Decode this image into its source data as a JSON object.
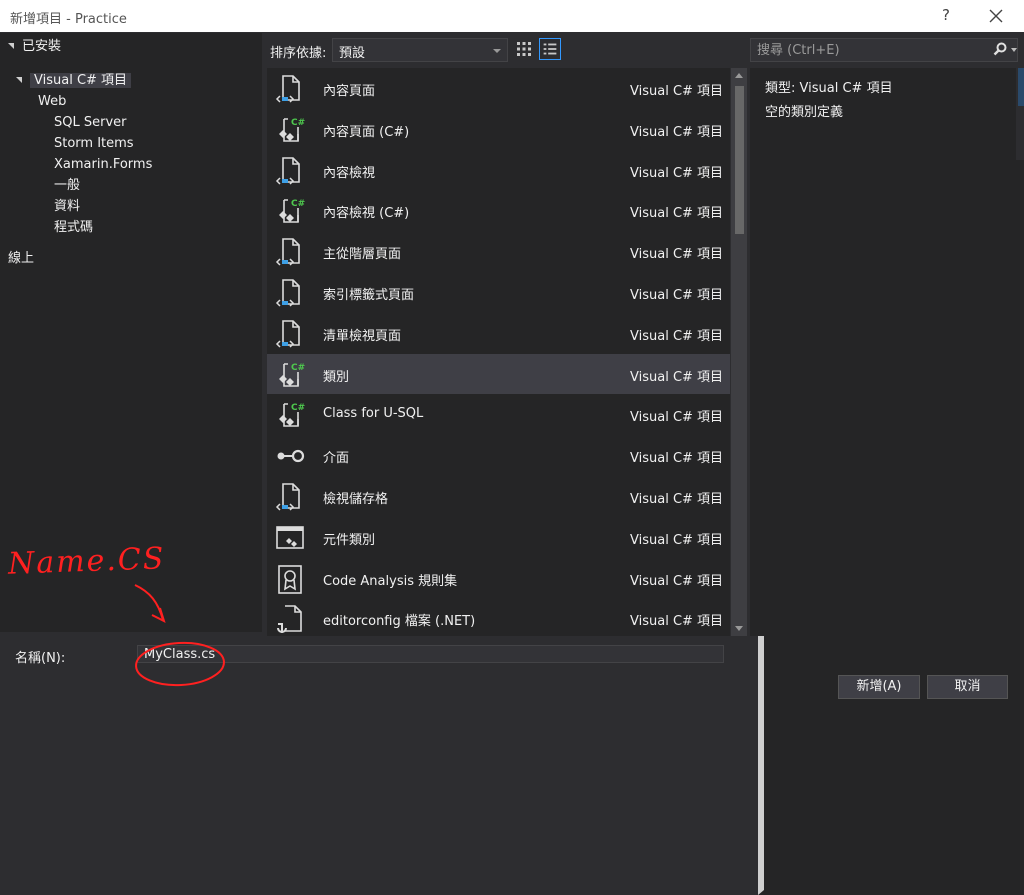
{
  "window": {
    "title": "新增項目 - Practice",
    "help_glyph": "?"
  },
  "tree": {
    "installed": "已安裝",
    "selected": "Visual C# 項目",
    "children": [
      "Web",
      "SQL Server",
      "Storm Items",
      "Xamarin.Forms",
      "一般",
      "資料",
      "程式碼"
    ],
    "online": "線上"
  },
  "toolbar": {
    "sort_label": "排序依據:",
    "sort_value": "預設"
  },
  "search": {
    "placeholder": "搜尋 (Ctrl+E)"
  },
  "templates": [
    {
      "name": "內容頁面",
      "type": "Visual C# 項目",
      "icon": "page-icon"
    },
    {
      "name": "內容頁面 (C#)",
      "type": "Visual C# 項目",
      "icon": "csharp-class-icon"
    },
    {
      "name": "內容檢視",
      "type": "Visual C# 項目",
      "icon": "page-icon"
    },
    {
      "name": "內容檢視 (C#)",
      "type": "Visual C# 項目",
      "icon": "csharp-class-icon"
    },
    {
      "name": "主從階層頁面",
      "type": "Visual C# 項目",
      "icon": "page-icon"
    },
    {
      "name": "索引標籤式頁面",
      "type": "Visual C# 項目",
      "icon": "page-icon"
    },
    {
      "name": "清單檢視頁面",
      "type": "Visual C# 項目",
      "icon": "page-icon"
    },
    {
      "name": "類別",
      "type": "Visual C# 項目",
      "icon": "csharp-class-icon"
    },
    {
      "name": "Class for U-SQL",
      "type": "Visual C# 項目",
      "icon": "csharp-class-icon"
    },
    {
      "name": "介面",
      "type": "Visual C# 項目",
      "icon": "interface-icon"
    },
    {
      "name": "檢視儲存格",
      "type": "Visual C# 項目",
      "icon": "page-icon"
    },
    {
      "name": "元件類別",
      "type": "Visual C# 項目",
      "icon": "component-icon"
    },
    {
      "name": "Code Analysis 規則集",
      "type": "Visual C# 項目",
      "icon": "ruleset-icon"
    },
    {
      "name": "editorconfig 檔案 (.NET)",
      "type": "Visual C# 項目",
      "icon": "editorconfig-icon"
    }
  ],
  "details": {
    "type_label": "類型:",
    "type_value": "Visual C# 項目",
    "description": "空的類別定義"
  },
  "name_field": {
    "label": "名稱(N):",
    "value": "MyClass.cs"
  },
  "buttons": {
    "add": "新增(A)",
    "cancel": "取消"
  },
  "annotation": {
    "text": "Name.CS"
  },
  "colors": {
    "background": "#2d2d30",
    "panel": "#252526",
    "selection": "#3f3f46",
    "accent": "#3399ff",
    "icon_green": "#4ec94e",
    "annotation_red": "#ff2020"
  }
}
